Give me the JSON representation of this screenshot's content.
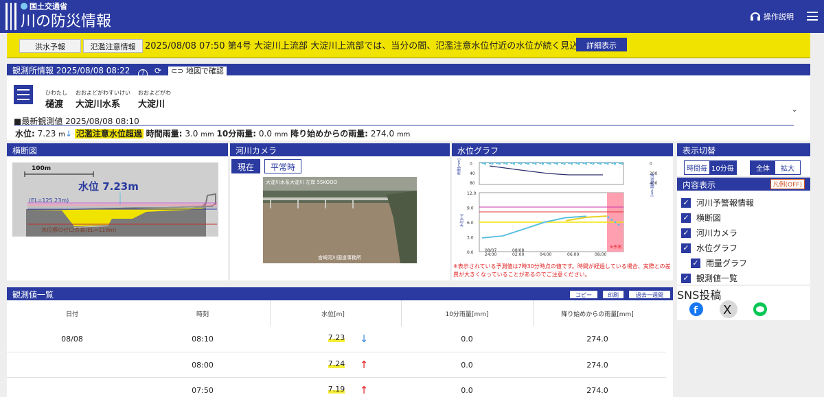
{
  "header": {
    "ministry": "国土交通省",
    "title": "川の防災情報",
    "help_label": "操作説明"
  },
  "alert": {
    "tag1": "洪水予報",
    "tag2": "氾濫注意情報",
    "message": "2025/08/08 07:50 第4号  大淀川上流部  大淀川上流部では、当分の間、氾濫注意水位付近の水位が続く見込み",
    "detail_button": "詳細表示"
  },
  "obs": {
    "title": "観測所情報 2025/08/08 08:22",
    "help": "?",
    "map_button": "地図で確認"
  },
  "station": {
    "names": [
      {
        "ruby": "ひわたし",
        "name": "樋渡"
      },
      {
        "ruby": "おおよどがわすいけい",
        "name": "大淀川水系"
      },
      {
        "ruby": "おおよどがわ",
        "name": "大淀川"
      }
    ],
    "latest_label": "■最新観測値",
    "latest_time": "2025/08/08 08:10",
    "water_label": "水位:",
    "water_value": "7.23",
    "water_unit": "m",
    "status": "氾濫注意水位超過",
    "hourly_label": "時間雨量:",
    "hourly_value": "3.0",
    "hourly_unit": "mm",
    "ten_label": "10分雨量:",
    "ten_value": "0.0",
    "ten_unit": "mm",
    "since_label": "降り始めからの雨量:",
    "since_value": "274.0",
    "since_unit": "mm"
  },
  "cross": {
    "title": "横断図",
    "scale": "100m",
    "level_text": "水位 7.23m",
    "el_text": "(EL=125.23m)",
    "zero_text": "水位標のゼロ点高(EL=118m)"
  },
  "camera": {
    "title": "河川カメラ",
    "tab_now": "現在",
    "tab_normal": "平常時",
    "caption": "大淀川水系大淀川  左岸  55KOOO",
    "watermark": "宮崎河川国道事務所"
  },
  "graph": {
    "title": "水位グラフ",
    "rain_axis_label": "雨量[mm]",
    "rain_axis_label2": "累加雨量[mm]",
    "wl_axis_label": "水位[m]",
    "forecast_label": "※予測",
    "note": "※表示されている予測値は7時30分時点の値です。時間が経過している場合、実際との差異が大きくなっていることがあるのでご注意ください。"
  },
  "chart_data": {
    "type": "line",
    "x": [
      "08/07 24:00",
      "08/08 02:00",
      "08/08 04:00",
      "08/08 06:00",
      "08/08 08:00"
    ],
    "ylim": [
      0,
      12
    ],
    "series": [
      {
        "values": [
          2.8,
          3.2,
          4.6,
          6.0,
          6.9,
          7.2
        ]
      },
      {
        "values": [
          6.3,
          7.0,
          7.23
        ]
      }
    ],
    "rain_ticks": [
      "0",
      "40",
      "80"
    ],
    "cum_ticks": [
      "0",
      "200",
      "400"
    ],
    "y_ticks": [
      "0.0",
      "3.0",
      "6.0",
      "9.0",
      "12.0"
    ],
    "x_labels": [
      "08/07\n24:00",
      "08/08\n02:00",
      "04:00",
      "06:00",
      "08:00"
    ]
  },
  "display": {
    "title": "表示切替",
    "hourly": "時間毎",
    "ten_min": "10分毎",
    "all": "全体",
    "zoom": "拡大"
  },
  "contents": {
    "title": "内容表示",
    "legend_btn": "凡例(OFF)",
    "items": [
      "河川予警報情報",
      "横断図",
      "河川カメラ",
      "水位グラフ",
      "雨量グラフ",
      "観測値一覧"
    ]
  },
  "sns": {
    "title": "SNS投稿"
  },
  "table": {
    "title": "観測値一覧",
    "buttons": [
      "コピー",
      "印刷",
      "過去一週間"
    ],
    "headers": [
      "日付",
      "時刻",
      "水位[m]",
      "10分雨量[mm]",
      "降り始めからの雨量[mm]"
    ],
    "rows": [
      {
        "date": "08/08",
        "time": "08:10",
        "wl": "7.23",
        "ten": "0.0",
        "since": "274.0",
        "dir": "↓"
      },
      {
        "date": "",
        "time": "08:00",
        "wl": "7.24",
        "ten": "0.0",
        "since": "274.0",
        "dir": "↑"
      },
      {
        "date": "",
        "time": "07:50",
        "wl": "7.19",
        "ten": "0.0",
        "since": "274.0",
        "dir": "↑"
      }
    ]
  },
  "colors": {
    "brand": "#2a3aa0",
    "alert": "#f1e300",
    "forecast": "#ff9fb0",
    "wl_line": "#5bc0e0",
    "danger": "#cc33aa"
  }
}
